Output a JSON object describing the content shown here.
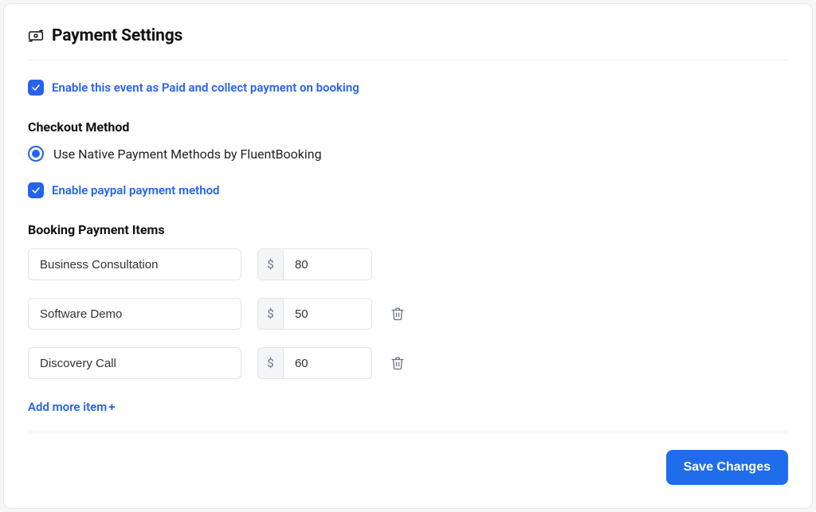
{
  "header": {
    "title": "Payment Settings"
  },
  "paid_toggle": {
    "checked": true,
    "label": "Enable this event as Paid and collect payment on booking"
  },
  "checkout": {
    "title": "Checkout Method",
    "option_label": "Use Native Payment Methods by FluentBooking",
    "selected": true
  },
  "paypal_toggle": {
    "checked": true,
    "label": "Enable paypal payment method"
  },
  "items": {
    "title": "Booking Payment Items",
    "currency_symbol": "$",
    "rows": [
      {
        "name": "Business Consultation",
        "price": "80",
        "deletable": false
      },
      {
        "name": "Software Demo",
        "price": "50",
        "deletable": true
      },
      {
        "name": "Discovery Call",
        "price": "60",
        "deletable": true
      }
    ]
  },
  "add_more_label": "Add more item",
  "save_label": "Save Changes"
}
